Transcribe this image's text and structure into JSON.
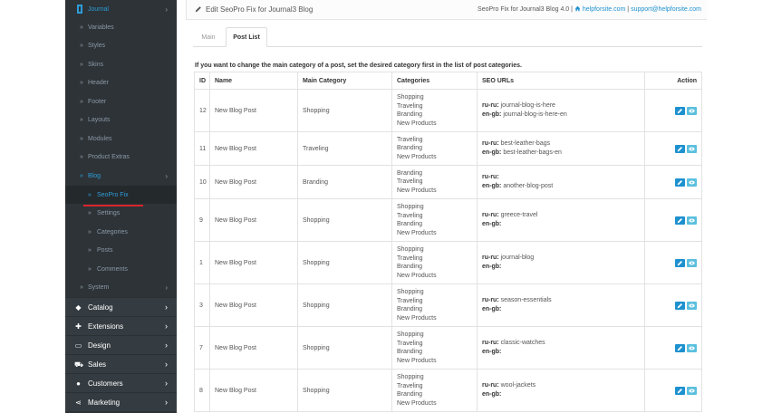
{
  "sidebar": {
    "journal": {
      "label": "Journal"
    },
    "sub_items": [
      {
        "label": "Variables"
      },
      {
        "label": "Styles"
      },
      {
        "label": "Skins"
      },
      {
        "label": "Header"
      },
      {
        "label": "Footer"
      },
      {
        "label": "Layouts"
      },
      {
        "label": "Modules"
      },
      {
        "label": "Product Extras"
      }
    ],
    "blog": {
      "label": "Blog"
    },
    "blog_items": [
      {
        "label": "SeoPro Fix"
      },
      {
        "label": "Settings"
      },
      {
        "label": "Categories"
      },
      {
        "label": "Posts"
      },
      {
        "label": "Comments"
      }
    ],
    "system": {
      "label": "System"
    },
    "main_items": [
      {
        "label": "Catalog",
        "icon": "tag-icon"
      },
      {
        "label": "Extensions",
        "icon": "puzzle-icon"
      },
      {
        "label": "Design",
        "icon": "desktop-icon"
      },
      {
        "label": "Sales",
        "icon": "cart-icon"
      },
      {
        "label": "Customers",
        "icon": "user-icon"
      },
      {
        "label": "Marketing",
        "icon": "share-icon"
      }
    ]
  },
  "header": {
    "title": "Edit SeoPro Fix for Journal3 Blog",
    "version": "SeoPro Fix for Journal3 Blog 4.0 |",
    "site_link": "helpforsite.com",
    "separator": "|",
    "email_link": "support@helpforsite.com"
  },
  "tabs": [
    {
      "label": "Main"
    },
    {
      "label": "Post List"
    }
  ],
  "notice": "If you want to change the main category of a post, set the desired category first in the list of post categories.",
  "table": {
    "headers": [
      "ID",
      "Name",
      "Main Category",
      "Categories",
      "SEO URLs",
      "Action"
    ],
    "rows": [
      {
        "id": "12",
        "name": "New Blog Post",
        "main": "Shopping",
        "cats": [
          "Shopping",
          "Traveling",
          "Branding",
          "New Products"
        ],
        "ru_label": "ru-ru:",
        "ru": "journal-blog-is-here",
        "en_label": "en-gb:",
        "en": "journal-blog-is-here-en"
      },
      {
        "id": "11",
        "name": "New Blog Post",
        "main": "Traveling",
        "cats": [
          "Traveling",
          "Branding",
          "New Products"
        ],
        "ru_label": "ru-ru:",
        "ru": "best-leather-bags",
        "en_label": "en-gb:",
        "en": "best-leather-bags-en"
      },
      {
        "id": "10",
        "name": "New Blog Post",
        "main": "Branding",
        "cats": [
          "Branding",
          "Traveling",
          "New Products"
        ],
        "ru_label": "ru-ru:",
        "ru": "",
        "en_label": "en-gb:",
        "en": "another-blog-post"
      },
      {
        "id": "9",
        "name": "New Blog Post",
        "main": "Shopping",
        "cats": [
          "Shopping",
          "Traveling",
          "Branding",
          "New Products"
        ],
        "ru_label": "ru-ru:",
        "ru": "greece-travel",
        "en_label": "en-gb:",
        "en": ""
      },
      {
        "id": "1",
        "name": "New Blog Post",
        "main": "Shopping",
        "cats": [
          "Shopping",
          "Traveling",
          "Branding",
          "New Products"
        ],
        "ru_label": "ru-ru:",
        "ru": "journal-blog",
        "en_label": "en-gb:",
        "en": ""
      },
      {
        "id": "3",
        "name": "New Blog Post",
        "main": "Shopping",
        "cats": [
          "Shopping",
          "Traveling",
          "Branding",
          "New Products"
        ],
        "ru_label": "ru-ru:",
        "ru": "season-essentials",
        "en_label": "en-gb:",
        "en": ""
      },
      {
        "id": "7",
        "name": "New Blog Post",
        "main": "Shopping",
        "cats": [
          "Shopping",
          "Traveling",
          "Branding",
          "New Products"
        ],
        "ru_label": "ru-ru:",
        "ru": "classic-watches",
        "en_label": "en-gb:",
        "en": ""
      },
      {
        "id": "8",
        "name": "New Blog Post",
        "main": "Shopping",
        "cats": [
          "Shopping",
          "Traveling",
          "Branding",
          "New Products"
        ],
        "ru_label": "ru-ru:",
        "ru": "wool-jackets",
        "en_label": "en-gb:",
        "en": ""
      }
    ]
  },
  "colors": {
    "sidebar_bg": "#2d3337",
    "accent": "#2e9dd8",
    "active_underline": "#d9262b",
    "edit_button": "#1e91cf",
    "view_button": "#5bc0de"
  }
}
